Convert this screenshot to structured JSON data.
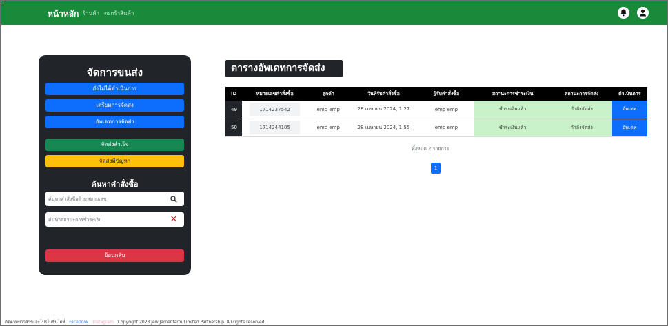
{
  "nav": {
    "home": "หน้าหลัก",
    "links": [
      "ร้านค้า",
      "ตะกร้าสินค้า"
    ],
    "icons": [
      "bell-icon",
      "user-icon"
    ]
  },
  "panel": {
    "title": "จัดการขนส่ง",
    "buttons": [
      "ยังไม่ได้ดำเนินการ",
      "เตรียมการจัดส่ง",
      "อัพเดทการจัดส่ง"
    ],
    "success_label": "จัดส่งสำเร็จ",
    "problem_label": "จัดส่งมีปัญหา",
    "search_title": "ค้นหาคำสั่งซื้อ",
    "search_order_placeholder": "ค้นหาคำสั่งซื้อด้วยหมายเลข",
    "search_payment_placeholder": "ค้นหาสถานะการชำระเงิน",
    "back_label": "ย้อนกลับ"
  },
  "table": {
    "title": "ตารางอัพเดทการจัดส่ง",
    "headers": [
      "ID",
      "หมายเลขคำสั่งซื้อ",
      "ลูกค้า",
      "วันที่รับคำสั่งซื้อ",
      "ผู้รับคำสั่งซื้อ",
      "สถานะการชำระเงิน",
      "สถานะการจัดส่ง",
      "ดำเนินการ"
    ],
    "rows": [
      {
        "id": "49",
        "order": "1714237542",
        "customer": "emp emp",
        "date": "28 เมษายน 2024, 1:27",
        "receiver": "emp emp",
        "payment": "ชำระเงินแล้ว",
        "shipping": "กำลังจัดส่ง",
        "action": "อัพเดท"
      },
      {
        "id": "50",
        "order": "1714244105",
        "customer": "emp emp",
        "date": "28 เมษายน 2024, 1:55",
        "receiver": "emp emp",
        "payment": "ชำระเงินแล้ว",
        "shipping": "กำลังจัดส่ง",
        "action": "อัพเดท"
      }
    ],
    "count": "ทั้งหมด 2 รายการ",
    "page": "1"
  },
  "footer": {
    "info": "ติดตามข่าวสารและโปรโมชั่นได้ที่",
    "facebook": "Facebook",
    "instagram": "Instagram",
    "copyright": "Copyright 2023 Jew Jaroenfarm Limited Partnership. All rights reserved."
  },
  "colors": {
    "nav": "#198a3a",
    "panel": "#212529",
    "primary": "#0d6efd",
    "success": "#198754",
    "warning": "#ffc107",
    "danger": "#dc3545",
    "paid_cell": "#c9f2c9"
  }
}
